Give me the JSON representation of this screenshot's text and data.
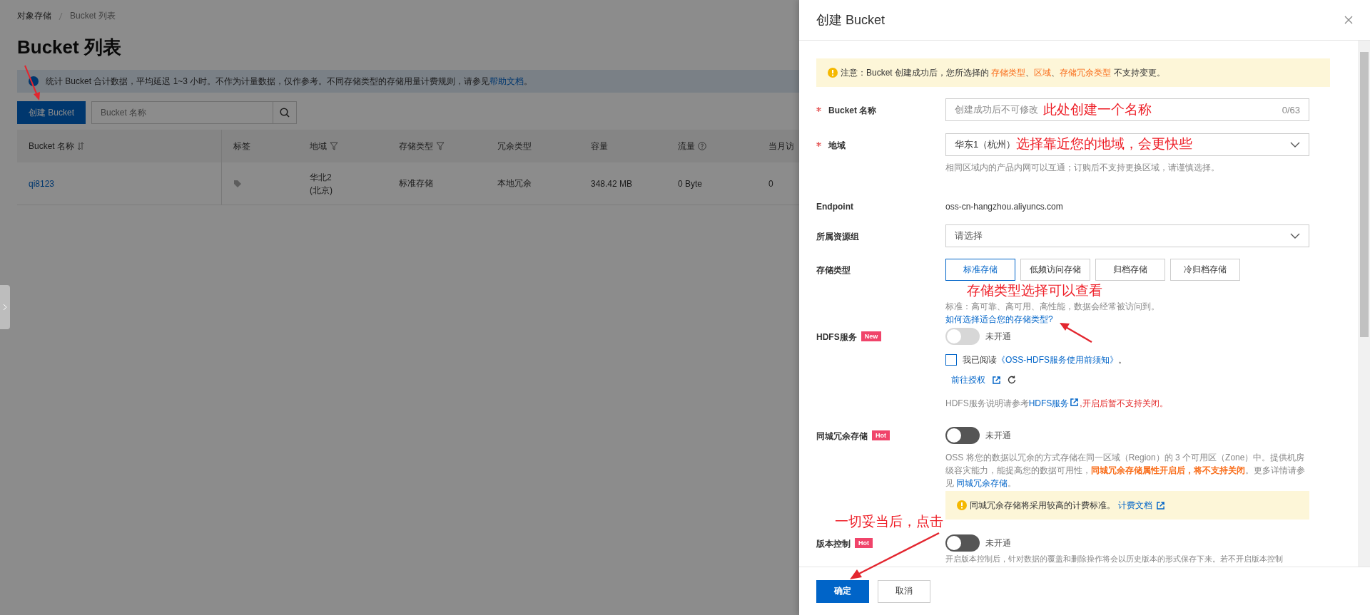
{
  "breadcrumb": [
    {
      "label": "对象存储"
    },
    {
      "label": "Bucket 列表"
    }
  ],
  "page_title": "Bucket 列表",
  "notice": [
    {
      "text": "统计 Bucket 合计数据，平均延迟 1~3 小时。不作为计量数据，仅作参考。不同存储类型的存储用量计费规则，请参见",
      "kind": "plain"
    },
    {
      "text": "帮助文档",
      "kind": "link"
    },
    {
      "text": "。",
      "kind": "plain"
    }
  ],
  "create_button": "创建 Bucket",
  "search": {
    "placeholder": "Bucket 名称"
  },
  "table": {
    "columns": [
      {
        "label": "Bucket 名称"
      },
      {
        "label": "标签"
      },
      {
        "label": "地域"
      },
      {
        "label": "存储类型"
      },
      {
        "label": "冗余类型"
      },
      {
        "label": "容量"
      },
      {
        "label": "流量"
      },
      {
        "label": "当月访"
      }
    ],
    "rows": [
      {
        "name": "qi8123",
        "region": [
          "华北2",
          "(北京)"
        ],
        "storage": "标准存储",
        "redundancy": "本地冗余",
        "capacity": "348.42 MB",
        "traffic": "0 Byte",
        "visits": "0"
      }
    ]
  },
  "drawer": {
    "title": "创建 Bucket",
    "notice": [
      {
        "text": "注意：Bucket 创建成功后，您所选择的 ",
        "kind": "plain"
      },
      {
        "text": "存储类型",
        "kind": "warn"
      },
      {
        "text": "、",
        "kind": "plain"
      },
      {
        "text": "区域",
        "kind": "warn"
      },
      {
        "text": "、",
        "kind": "plain"
      },
      {
        "text": "存储冗余类型",
        "kind": "warn"
      },
      {
        "text": " 不支持变更。",
        "kind": "plain"
      }
    ],
    "fields": [
      {
        "kind": "input",
        "label": "Bucket 名称",
        "required": true,
        "placeholder": "创建成功后不可修改",
        "counter": "0/63"
      },
      {
        "kind": "select",
        "label": "地域",
        "required": true,
        "value": "华东1（杭州）",
        "hint": [
          {
            "text": "相同区域内的产品内网可以互通；订购后不支持更换区域，请谨慎选择。",
            "kind": "plain"
          }
        ]
      },
      {
        "kind": "text",
        "label": "Endpoint",
        "value": "oss-cn-hangzhou.aliyuncs.com"
      },
      {
        "kind": "select",
        "label": "所属资源组",
        "required": false,
        "placeholder": "请选择"
      },
      {
        "kind": "options",
        "label": "存储类型",
        "options": [
          {
            "label": "标准存储",
            "selected": true
          },
          {
            "label": "低频访问存储",
            "selected": false
          },
          {
            "label": "归档存储",
            "selected": false
          },
          {
            "label": "冷归档存储",
            "selected": false
          }
        ],
        "hint": [
          {
            "text": "标准：高可靠、高可用、高性能，数据会经常被访问到。",
            "kind": "plain"
          }
        ],
        "link": "如何选择适合您的存储类型?"
      },
      {
        "kind": "hdfs",
        "label": "HDFS服务",
        "badge": "New",
        "toggle": {
          "on": false,
          "disabled": true,
          "label": "未开通"
        },
        "agreement": {
          "checked": false,
          "text": "我已阅读",
          "link": "《OSS-HDFS服务使用前须知》",
          "end": "。"
        },
        "auth_link": "前往授权",
        "hint": [
          {
            "text": "HDFS服务说明请参考",
            "kind": "plain"
          },
          {
            "text": "HDFS服务",
            "kind": "external-link"
          },
          {
            "text": ",开启后暂不支持关闭。",
            "kind": "danger"
          }
        ]
      },
      {
        "kind": "zrs",
        "label": "同城冗余存储",
        "badge": "Hot",
        "toggle": {
          "on": false,
          "disabled": false,
          "label": "未开通"
        },
        "hint": [
          {
            "text": "OSS 将您的数据以冗余的方式存储在同一区域（Region）的 3 个可用区（Zone）中。提供机房级容灾能力，能提高您的数据可用性，",
            "kind": "plain"
          },
          {
            "text": "同城冗余存储属性开启后，将不支持关闭",
            "kind": "strong-warn"
          },
          {
            "text": "。更多详情请参见 ",
            "kind": "plain"
          },
          {
            "text": "同城冗余存储",
            "kind": "link"
          },
          {
            "text": "。",
            "kind": "plain"
          }
        ],
        "alert": {
          "text": "同城冗余存储将采用较高的计费标准。",
          "link": "计费文档"
        }
      },
      {
        "kind": "version",
        "label": "版本控制",
        "badge": "Hot",
        "toggle": {
          "on": false,
          "disabled": false,
          "label": "未开通"
        },
        "hint": [
          {
            "text": "开启版本控制后，针对数据的覆盖和删除操作将会以历史版本的形式保存下来。若不开启版本控制",
            "kind": "plain"
          }
        ]
      }
    ],
    "buttons": [
      {
        "label": "确定",
        "primary": true
      },
      {
        "label": "取消",
        "primary": false
      }
    ]
  },
  "annotations": [
    {
      "text": "此处创建一个名称"
    },
    {
      "text": "选择靠近您的地域，会更快些"
    },
    {
      "text": "存储类型选择可以查看"
    },
    {
      "text": "一切妥当后，点击"
    }
  ]
}
